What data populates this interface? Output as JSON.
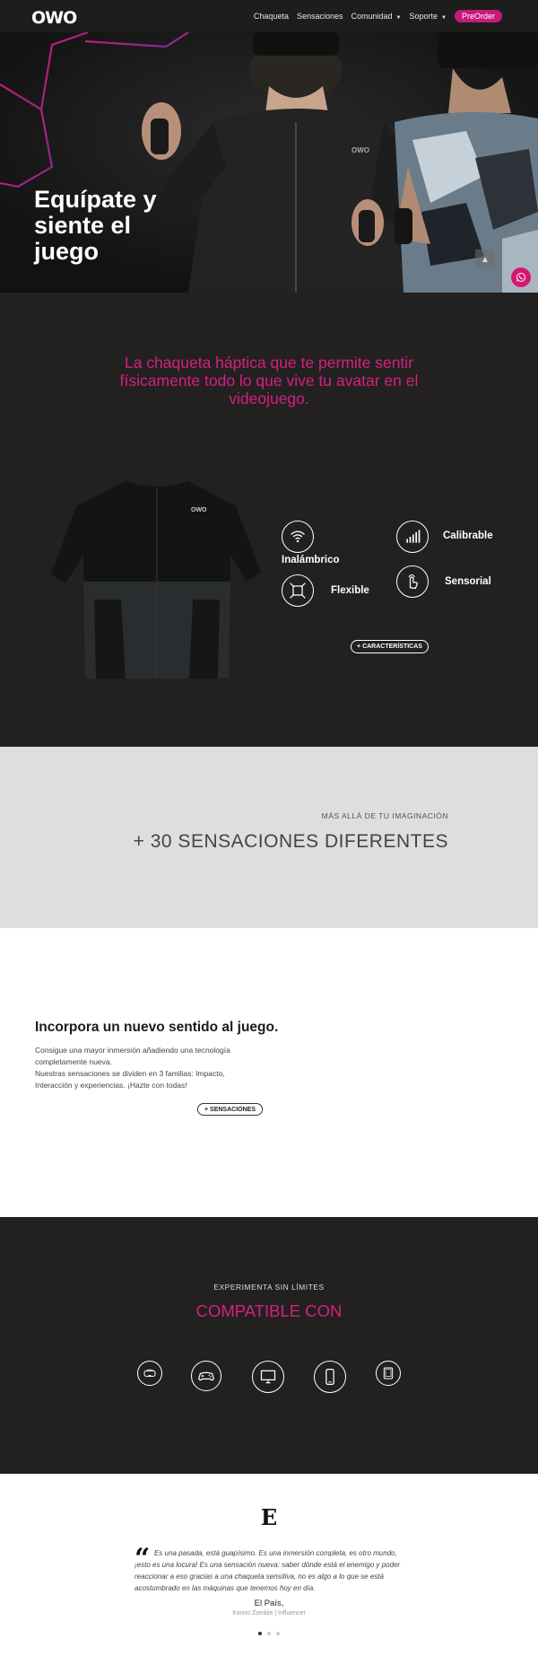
{
  "nav": {
    "logo": "OWO",
    "items": [
      {
        "label": "Chaqueta"
      },
      {
        "label": "Sensaciones"
      },
      {
        "label": "Comunidad"
      },
      {
        "label": "Soporte"
      }
    ],
    "preorder": "PreOrder"
  },
  "hero": {
    "title": "Equípate y siente el juego",
    "shirt_logo": "OWO"
  },
  "jacket": {
    "tagline": "La chaqueta háptica que te permite sentir físicamente todo lo que vive tu avatar en el videojuego.",
    "shirt_logo": "OWO",
    "features": [
      {
        "label": "Inalámbrico",
        "icon": "wifi-icon"
      },
      {
        "label": "Calibrable",
        "icon": "bars-icon"
      },
      {
        "label": "Flexible",
        "icon": "flex-icon"
      },
      {
        "label": "Sensorial",
        "icon": "touch-icon"
      }
    ],
    "button": "+ CARACTERÍSTICAS"
  },
  "sensaciones": {
    "small": "MÁS ALLÁ DE TU IMAGINACIÓN",
    "big": "+ 30 SENSACIONES DIFERENTES"
  },
  "incorpora": {
    "title": "Incorpora un nuevo sentido al juego.",
    "text1": "Consigue una mayor inmersión añadiendo una tecnología completamente nueva.",
    "text2": "Nuestras sensaciones se dividen en 3 familias: Impacto, Interacción y experiencias. ¡Hazte con todas!",
    "button": "+ SENSACIONES"
  },
  "compatible": {
    "small": "EXPERIMENTA SIN LÍMITES",
    "big": "COMPATIBLE CON",
    "devices": [
      "vr-headset-icon",
      "gamepad-icon",
      "pc-monitor-icon",
      "smartphone-icon",
      "tablet-icon"
    ]
  },
  "testimonial": {
    "logo": "E",
    "quote": "Es una pasada, está guapísimo. Es una inmersión completa, es otro mundo, ¡esto es una locura! Es una sensación nueva: saber dónde está el enemigo y poder reaccionar a eso gracias a una chaqueta sensitiva, no es algo a lo que se está acostumbrado en las máquinas que tenemos hoy en día.",
    "author": "El País,",
    "role": "Ironno Zombie | Influencer",
    "dots": 3,
    "active_dot": 0
  },
  "colors": {
    "accent": "#d4207f",
    "dark": "#222120",
    "light_gray": "#dedede"
  }
}
